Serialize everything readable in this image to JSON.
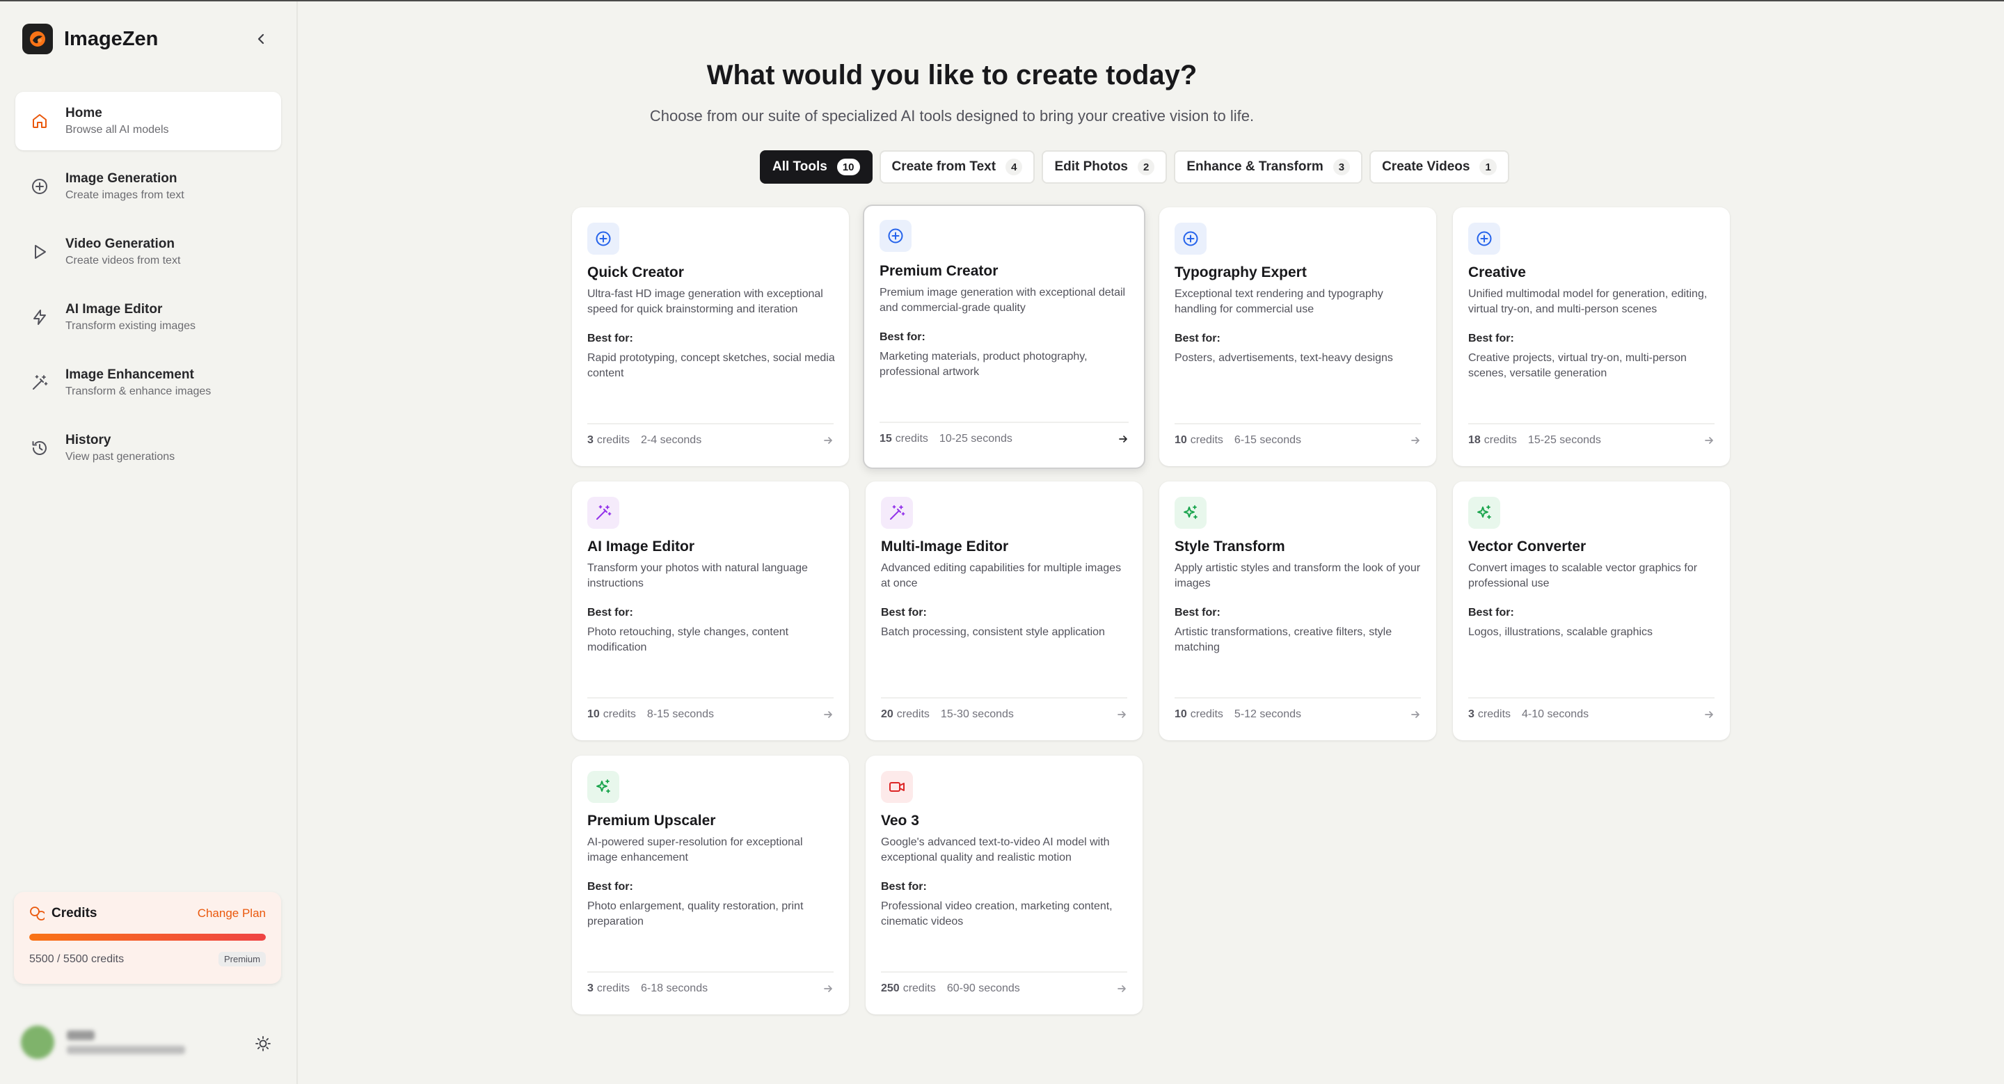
{
  "brand": {
    "name": "ImageZen",
    "accent": "#ea580c"
  },
  "sidebar": {
    "items": [
      {
        "label": "Home",
        "sub": "Browse all AI models",
        "icon": "home-icon"
      },
      {
        "label": "Image Generation",
        "sub": "Create images from text",
        "icon": "plus-circle-icon"
      },
      {
        "label": "Video Generation",
        "sub": "Create videos from text",
        "icon": "play-icon"
      },
      {
        "label": "AI Image Editor",
        "sub": "Transform existing images",
        "icon": "bolt-icon"
      },
      {
        "label": "Image Enhancement",
        "sub": "Transform & enhance images",
        "icon": "magic-wand-icon"
      },
      {
        "label": "History",
        "sub": "View past generations",
        "icon": "history-icon"
      }
    ],
    "credits": {
      "title": "Credits",
      "change_plan": "Change Plan",
      "count": "5500 / 5500 credits",
      "plan": "Premium",
      "fraction": 1.0
    }
  },
  "main": {
    "heading": "What would you like to create today?",
    "subheading": "Choose from our suite of specialized AI tools designed to bring your creative vision to life.",
    "tabs": [
      {
        "label": "All Tools",
        "count": "10",
        "active": true
      },
      {
        "label": "Create from Text",
        "count": "4"
      },
      {
        "label": "Edit Photos",
        "count": "2"
      },
      {
        "label": "Enhance & Transform",
        "count": "3"
      },
      {
        "label": "Create Videos",
        "count": "1"
      }
    ],
    "best_for_label": "Best for:",
    "credits_unit": "credits",
    "cards": [
      {
        "title": "Quick Creator",
        "desc": "Ultra-fast HD image generation with exceptional speed for quick brainstorming and iteration",
        "best": "Rapid prototyping, concept sketches, social media content",
        "credits": "3",
        "time": "2-4 seconds",
        "icon": "plus-circle-icon",
        "icon_color": "#2563eb"
      },
      {
        "title": "Premium Creator",
        "desc": "Premium image generation with exceptional detail and commercial-grade quality",
        "best": "Marketing materials, product photography, professional artwork",
        "credits": "15",
        "time": "10-25 seconds",
        "icon": "plus-circle-icon",
        "icon_color": "#2563eb"
      },
      {
        "title": "Typography Expert",
        "desc": "Exceptional text rendering and typography handling for commercial use",
        "best": "Posters, advertisements, text-heavy designs",
        "credits": "10",
        "time": "6-15 seconds",
        "icon": "plus-circle-icon",
        "icon_color": "#2563eb"
      },
      {
        "title": "Creative",
        "desc": "Unified multimodal model for generation, editing, virtual try-on, and multi-person scenes",
        "best": "Creative projects, virtual try-on, multi-person scenes, versatile generation",
        "credits": "18",
        "time": "15-25 seconds",
        "icon": "plus-circle-icon",
        "icon_color": "#2563eb"
      },
      {
        "title": "AI Image Editor",
        "desc": "Transform your photos with natural language instructions",
        "best": "Photo retouching, style changes, content modification",
        "credits": "10",
        "time": "8-15 seconds",
        "icon": "magic-wand-icon",
        "icon_color": "#9333ea"
      },
      {
        "title": "Multi-Image Editor",
        "desc": "Advanced editing capabilities for multiple images at once",
        "best": "Batch processing, consistent style application",
        "credits": "20",
        "time": "15-30 seconds",
        "icon": "magic-wand-icon",
        "icon_color": "#9333ea"
      },
      {
        "title": "Style Transform",
        "desc": "Apply artistic styles and transform the look of your images",
        "best": "Artistic transformations, creative filters, style matching",
        "credits": "10",
        "time": "5-12 seconds",
        "icon": "sparkles-icon",
        "icon_color": "#16a34a"
      },
      {
        "title": "Vector Converter",
        "desc": "Convert images to scalable vector graphics for professional use",
        "best": "Logos, illustrations, scalable graphics",
        "credits": "3",
        "time": "4-10 seconds",
        "icon": "sparkles-icon",
        "icon_color": "#16a34a"
      },
      {
        "title": "Premium Upscaler",
        "desc": "AI-powered super-resolution for exceptional image enhancement",
        "best": "Photo enlargement, quality restoration, print preparation",
        "credits": "3",
        "time": "6-18 seconds",
        "icon": "sparkles-icon",
        "icon_color": "#16a34a"
      },
      {
        "title": "Veo 3",
        "desc": "Google's advanced text-to-video AI model with exceptional quality and realistic motion",
        "best": "Professional video creation, marketing content, cinematic videos",
        "credits": "250",
        "time": "60-90 seconds",
        "icon": "video-camera-icon",
        "icon_color": "#dc2626"
      }
    ]
  }
}
